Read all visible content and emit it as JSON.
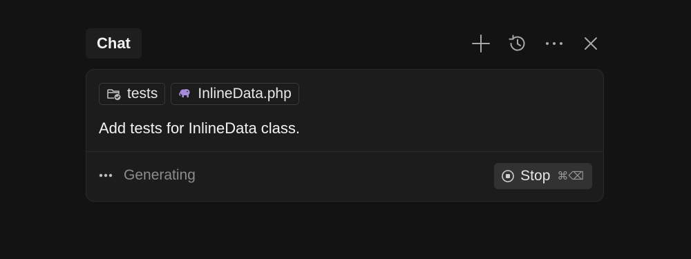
{
  "header": {
    "tab_label": "Chat",
    "actions": [
      {
        "name": "new-chat",
        "icon": "plus-icon"
      },
      {
        "name": "history",
        "icon": "history-icon"
      },
      {
        "name": "more",
        "icon": "more-horizontal-icon"
      },
      {
        "name": "close",
        "icon": "close-icon"
      }
    ]
  },
  "composer": {
    "context_chips": [
      {
        "label": "tests",
        "icon": "folder-check-icon"
      },
      {
        "label": "InlineData.php",
        "icon": "php-elephant-icon",
        "icon_color": "#a78bdb"
      }
    ],
    "message": "Add tests for InlineData class.",
    "status_text": "Generating",
    "stop_label": "Stop",
    "stop_shortcut": "⌘⌫"
  }
}
